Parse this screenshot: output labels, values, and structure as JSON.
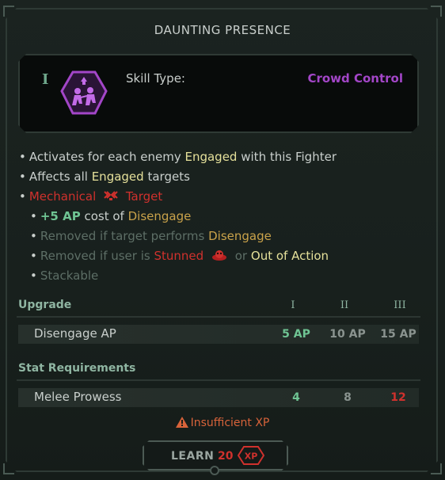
{
  "title": "DAUNTING PRESENCE",
  "tier": "I",
  "skill_icon": "crowd-control-icon",
  "skill_type": {
    "label": "Skill Type:",
    "value": "Crowd Control"
  },
  "description": {
    "line1": {
      "pre": "Activates for each enemy",
      "hl": "Engaged",
      "post": "with this Fighter"
    },
    "line2": {
      "pre": "Affects all",
      "hl": "Engaged",
      "post": "targets"
    },
    "line3": {
      "pre": "Mechanical",
      "icon": "mechanical-icon",
      "post": "Target"
    },
    "line4": {
      "hl": "+5 AP",
      "mid": "cost of",
      "post": "Disengage"
    },
    "line5": {
      "pre": "Removed if target performs",
      "post": "Disengage"
    },
    "line6": {
      "pre": "Removed if user is",
      "red": "Stunned",
      "icon": "stunned-icon",
      "or": "or",
      "post": "Out of Action"
    },
    "line7": {
      "text": "Stackable"
    }
  },
  "upgrade": {
    "heading": "Upgrade",
    "columns": [
      "I",
      "II",
      "III"
    ],
    "row": {
      "label": "Disengage AP",
      "values": [
        "5 AP",
        "10 AP",
        "15 AP"
      ]
    }
  },
  "requirements": {
    "heading": "Stat Requirements",
    "row": {
      "label": "Melee Prowess",
      "values": [
        "4",
        "8",
        "12"
      ]
    }
  },
  "warning": {
    "icon": "warning-icon",
    "text": "Insufficient XP"
  },
  "learn_button": {
    "label": "LEARN",
    "cost": "20",
    "unit": "XP"
  },
  "colors": {
    "accent": "#a346c8",
    "engaged": "#e5e09a",
    "danger": "#d0312d",
    "ap": "#6fc493",
    "disengage": "#c9a24a"
  }
}
